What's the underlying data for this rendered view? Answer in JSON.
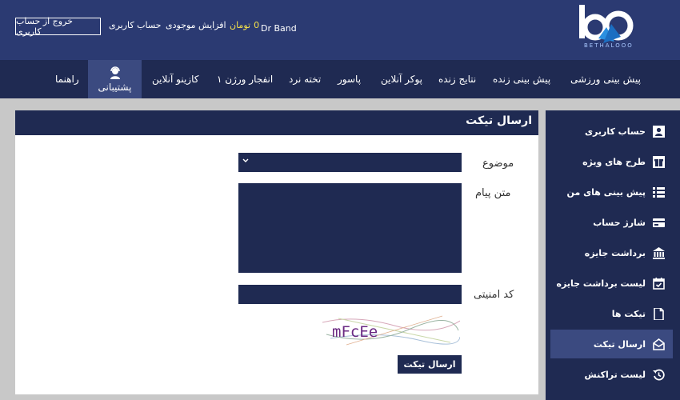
{
  "header": {
    "logo_text": "BETHALOOO",
    "username": "Dr Band",
    "balance_label": "تومان",
    "balance_value": "0",
    "increase_balance": "افزایش موجودی",
    "account": "حساب کاربری",
    "logout": "خروج از حساب کاربری"
  },
  "nav": {
    "items": [
      "پیش بینی ورزشی",
      "پیش بینی زنده",
      "نتایج زنده",
      "پوکر آنلاین",
      "پاسور",
      "تخته نرد",
      "انفجار ورژن ۱",
      "کازینو آنلاین",
      "پشتیبانی",
      "راهنما"
    ]
  },
  "sidebar": {
    "items": [
      {
        "label": "حساب کاربری",
        "icon": "user-icon"
      },
      {
        "label": "طرح های ویژه",
        "icon": "gift-icon"
      },
      {
        "label": "پیش بینی های من",
        "icon": "list-icon"
      },
      {
        "label": "شارژ حساب",
        "icon": "card-icon"
      },
      {
        "label": "برداشت جایزه",
        "icon": "bank-icon"
      },
      {
        "label": "لیست برداشت جایزه",
        "icon": "calendar-check-icon"
      },
      {
        "label": "تیکت ها",
        "icon": "file-icon"
      },
      {
        "label": "ارسال تیکت",
        "icon": "envelope-open-icon"
      },
      {
        "label": "لیست تراکنش",
        "icon": "history-icon"
      }
    ]
  },
  "ticket_form": {
    "title": "ارسال تیکت",
    "subject_label": "موضوع",
    "message_label": "متن پیام",
    "captcha_label": "کد امنیتی",
    "captcha_text": "mFcEe",
    "submit": "ارسال تیکت"
  },
  "colors": {
    "header_bg": "#2b3a72",
    "nav_bg": "#1f2a52",
    "active_bg": "#3b4a80",
    "balance_accent": "#f3e04a"
  }
}
